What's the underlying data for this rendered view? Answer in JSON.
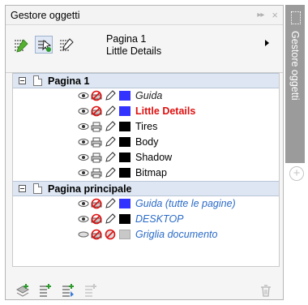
{
  "panel": {
    "title": "Gestore oggetti",
    "page_info": {
      "page": "Pagina 1",
      "layer": "Little Details"
    }
  },
  "groups": [
    {
      "label": "Pagina 1",
      "layers": [
        {
          "label": "Guida",
          "style": "italic",
          "color": "#222222",
          "swatch": "#3333ff",
          "icons": "eye-noprint-pencil"
        },
        {
          "label": "Little Details",
          "style": "bold-active",
          "color": "#e01010",
          "swatch": "#3333ff",
          "icons": "eye-noprint-pencil"
        },
        {
          "label": "Tires",
          "style": "normal",
          "color": "#000000",
          "swatch": "#000000",
          "icons": "eye-print-pencil"
        },
        {
          "label": "Body",
          "style": "normal",
          "color": "#000000",
          "swatch": "#000000",
          "icons": "eye-print-pencil"
        },
        {
          "label": "Shadow",
          "style": "normal",
          "color": "#000000",
          "swatch": "#000000",
          "icons": "eye-print-pencil"
        },
        {
          "label": "Bitmap",
          "style": "normal",
          "color": "#000000",
          "swatch": "#000000",
          "icons": "eye-print-pencil"
        }
      ]
    },
    {
      "label": "Pagina principale",
      "layers": [
        {
          "label": "Guida (tutte le pagine)",
          "style": "italic",
          "color": "#2a6ac8",
          "swatch": "#3333ff",
          "icons": "eye-noprint-pencil"
        },
        {
          "label": "DESKTOP",
          "style": "italic",
          "color": "#2a6ac8",
          "swatch": "#000000",
          "icons": "eye-noprint-pencil"
        },
        {
          "label": "Griglia documento",
          "style": "italic",
          "color": "#2a6ac8",
          "swatch": "#c8c8c8",
          "icons": "hidden-noprint-locked"
        }
      ]
    }
  ],
  "side_tab": {
    "label": "Gestore oggetti"
  },
  "icons": {
    "toolbar": [
      "show-object-properties-icon",
      "edit-across-layers-icon",
      "layer-manager-view-icon"
    ],
    "bottom": [
      "new-layer-icon",
      "new-master-layer-icon",
      "new-master-layer-all-icon",
      "new-master-layer-odd-icon",
      "delete-icon"
    ]
  }
}
